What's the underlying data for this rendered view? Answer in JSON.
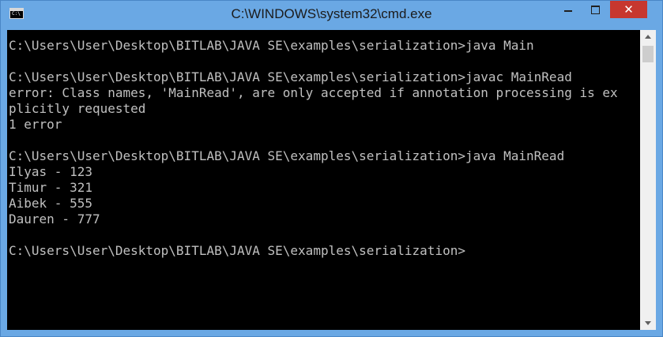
{
  "window": {
    "title": "C:\\WINDOWS\\system32\\cmd.exe",
    "icon": "cmd-icon",
    "icon_text": "C:\\",
    "close_glyph": "✕"
  },
  "console": {
    "lines": [
      "C:\\Users\\User\\Desktop\\BITLAB\\JAVA SE\\examples\\serialization>java Main",
      "",
      "C:\\Users\\User\\Desktop\\BITLAB\\JAVA SE\\examples\\serialization>javac MainRead",
      "error: Class names, 'MainRead', are only accepted if annotation processing is ex",
      "plicitly requested",
      "1 error",
      "",
      "C:\\Users\\User\\Desktop\\BITLAB\\JAVA SE\\examples\\serialization>java MainRead",
      "Ilyas - 123",
      "Timur - 321",
      "Aibek - 555",
      "Dauren - 777",
      "",
      "C:\\Users\\User\\Desktop\\BITLAB\\JAVA SE\\examples\\serialization>"
    ]
  },
  "colors": {
    "frame": "#6aa8e4",
    "console_bg": "#000000",
    "console_text": "#c0c0c0",
    "close_button": "#c7372f"
  }
}
